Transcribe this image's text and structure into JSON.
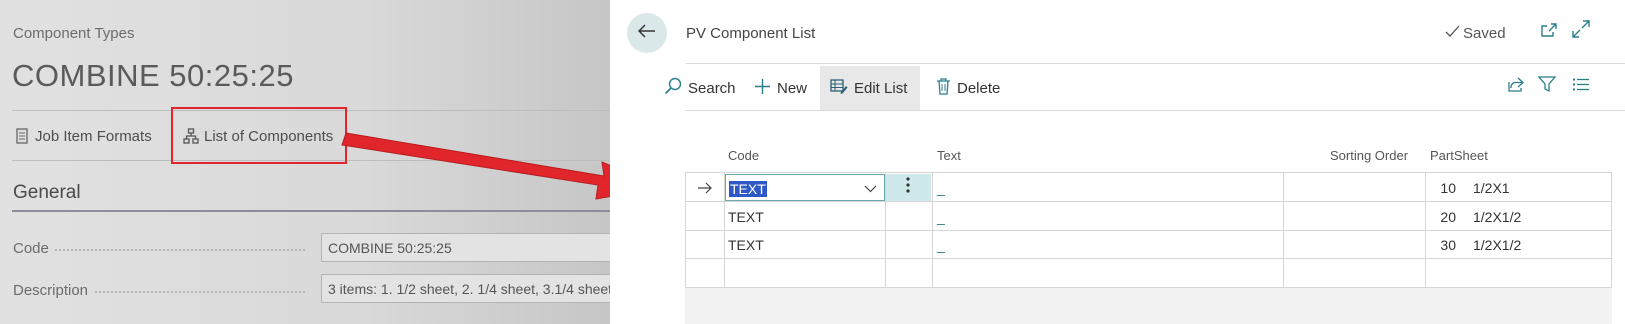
{
  "background_page": {
    "caption": "Component Types",
    "title": "COMBINE 50:25:25",
    "actions": [
      {
        "label": "Job Item Formats",
        "icon": "document-icon"
      },
      {
        "label": "List of Components",
        "icon": "hierarchy-icon"
      }
    ],
    "section": "General",
    "fields": [
      {
        "label": "Code",
        "value": "COMBINE 50:25:25"
      },
      {
        "label": "Description",
        "value": "3 items: 1. 1/2 sheet, 2. 1/4 sheet, 3.1/4 sheet"
      }
    ]
  },
  "panel": {
    "title": "PV Component List",
    "status": "Saved",
    "toolbar": {
      "search": "Search",
      "new": "New",
      "edit_list": "Edit List",
      "delete": "Delete"
    },
    "columns": {
      "code": "Code",
      "text": "Text",
      "sorting_order": "Sorting Order",
      "partsheet": "PartSheet"
    },
    "rows": [
      {
        "code": "TEXT",
        "text": "_",
        "sorting_order": "10",
        "partsheet": "1/2X1",
        "selected": true
      },
      {
        "code": "TEXT",
        "text": "_",
        "sorting_order": "20",
        "partsheet": "1/2X1/2",
        "selected": false
      },
      {
        "code": "TEXT",
        "text": "_",
        "sorting_order": "30",
        "partsheet": "1/2X1/2",
        "selected": false
      }
    ]
  },
  "colors": {
    "highlight_red": "#e0262b",
    "accent_teal": "#2a7e8c",
    "selection_blue": "#2e58c7"
  }
}
